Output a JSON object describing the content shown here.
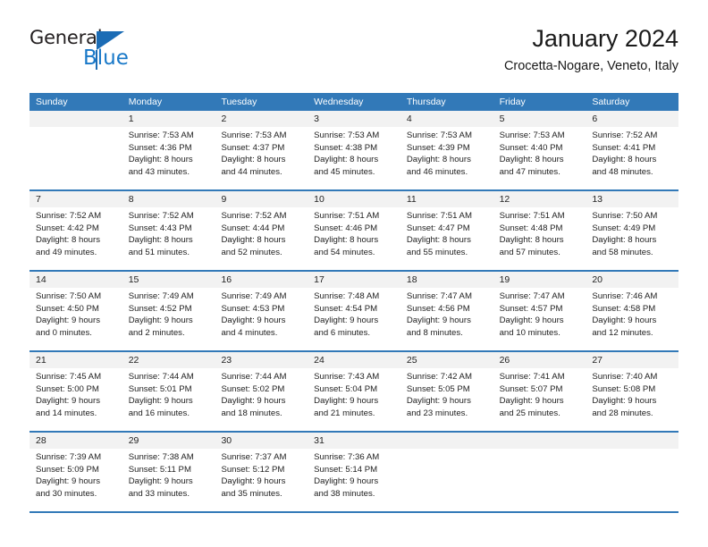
{
  "brand": {
    "name_primary": "General",
    "name_secondary": "Blue",
    "triangle_icon": "triangle-icon",
    "accent_color": "#1878c8"
  },
  "header": {
    "title": "January 2024",
    "subtitle": "Crocetta-Nogare, Veneto, Italy"
  },
  "calendar": {
    "header_bg": "#3279b8",
    "weekday_labels": [
      "Sunday",
      "Monday",
      "Tuesday",
      "Wednesday",
      "Thursday",
      "Friday",
      "Saturday"
    ],
    "weeks": [
      [
        {
          "day": "",
          "lines": []
        },
        {
          "day": "1",
          "lines": [
            "Sunrise: 7:53 AM",
            "Sunset: 4:36 PM",
            "Daylight: 8 hours",
            "and 43 minutes."
          ]
        },
        {
          "day": "2",
          "lines": [
            "Sunrise: 7:53 AM",
            "Sunset: 4:37 PM",
            "Daylight: 8 hours",
            "and 44 minutes."
          ]
        },
        {
          "day": "3",
          "lines": [
            "Sunrise: 7:53 AM",
            "Sunset: 4:38 PM",
            "Daylight: 8 hours",
            "and 45 minutes."
          ]
        },
        {
          "day": "4",
          "lines": [
            "Sunrise: 7:53 AM",
            "Sunset: 4:39 PM",
            "Daylight: 8 hours",
            "and 46 minutes."
          ]
        },
        {
          "day": "5",
          "lines": [
            "Sunrise: 7:53 AM",
            "Sunset: 4:40 PM",
            "Daylight: 8 hours",
            "and 47 minutes."
          ]
        },
        {
          "day": "6",
          "lines": [
            "Sunrise: 7:52 AM",
            "Sunset: 4:41 PM",
            "Daylight: 8 hours",
            "and 48 minutes."
          ]
        }
      ],
      [
        {
          "day": "7",
          "lines": [
            "Sunrise: 7:52 AM",
            "Sunset: 4:42 PM",
            "Daylight: 8 hours",
            "and 49 minutes."
          ]
        },
        {
          "day": "8",
          "lines": [
            "Sunrise: 7:52 AM",
            "Sunset: 4:43 PM",
            "Daylight: 8 hours",
            "and 51 minutes."
          ]
        },
        {
          "day": "9",
          "lines": [
            "Sunrise: 7:52 AM",
            "Sunset: 4:44 PM",
            "Daylight: 8 hours",
            "and 52 minutes."
          ]
        },
        {
          "day": "10",
          "lines": [
            "Sunrise: 7:51 AM",
            "Sunset: 4:46 PM",
            "Daylight: 8 hours",
            "and 54 minutes."
          ]
        },
        {
          "day": "11",
          "lines": [
            "Sunrise: 7:51 AM",
            "Sunset: 4:47 PM",
            "Daylight: 8 hours",
            "and 55 minutes."
          ]
        },
        {
          "day": "12",
          "lines": [
            "Sunrise: 7:51 AM",
            "Sunset: 4:48 PM",
            "Daylight: 8 hours",
            "and 57 minutes."
          ]
        },
        {
          "day": "13",
          "lines": [
            "Sunrise: 7:50 AM",
            "Sunset: 4:49 PM",
            "Daylight: 8 hours",
            "and 58 minutes."
          ]
        }
      ],
      [
        {
          "day": "14",
          "lines": [
            "Sunrise: 7:50 AM",
            "Sunset: 4:50 PM",
            "Daylight: 9 hours",
            "and 0 minutes."
          ]
        },
        {
          "day": "15",
          "lines": [
            "Sunrise: 7:49 AM",
            "Sunset: 4:52 PM",
            "Daylight: 9 hours",
            "and 2 minutes."
          ]
        },
        {
          "day": "16",
          "lines": [
            "Sunrise: 7:49 AM",
            "Sunset: 4:53 PM",
            "Daylight: 9 hours",
            "and 4 minutes."
          ]
        },
        {
          "day": "17",
          "lines": [
            "Sunrise: 7:48 AM",
            "Sunset: 4:54 PM",
            "Daylight: 9 hours",
            "and 6 minutes."
          ]
        },
        {
          "day": "18",
          "lines": [
            "Sunrise: 7:47 AM",
            "Sunset: 4:56 PM",
            "Daylight: 9 hours",
            "and 8 minutes."
          ]
        },
        {
          "day": "19",
          "lines": [
            "Sunrise: 7:47 AM",
            "Sunset: 4:57 PM",
            "Daylight: 9 hours",
            "and 10 minutes."
          ]
        },
        {
          "day": "20",
          "lines": [
            "Sunrise: 7:46 AM",
            "Sunset: 4:58 PM",
            "Daylight: 9 hours",
            "and 12 minutes."
          ]
        }
      ],
      [
        {
          "day": "21",
          "lines": [
            "Sunrise: 7:45 AM",
            "Sunset: 5:00 PM",
            "Daylight: 9 hours",
            "and 14 minutes."
          ]
        },
        {
          "day": "22",
          "lines": [
            "Sunrise: 7:44 AM",
            "Sunset: 5:01 PM",
            "Daylight: 9 hours",
            "and 16 minutes."
          ]
        },
        {
          "day": "23",
          "lines": [
            "Sunrise: 7:44 AM",
            "Sunset: 5:02 PM",
            "Daylight: 9 hours",
            "and 18 minutes."
          ]
        },
        {
          "day": "24",
          "lines": [
            "Sunrise: 7:43 AM",
            "Sunset: 5:04 PM",
            "Daylight: 9 hours",
            "and 21 minutes."
          ]
        },
        {
          "day": "25",
          "lines": [
            "Sunrise: 7:42 AM",
            "Sunset: 5:05 PM",
            "Daylight: 9 hours",
            "and 23 minutes."
          ]
        },
        {
          "day": "26",
          "lines": [
            "Sunrise: 7:41 AM",
            "Sunset: 5:07 PM",
            "Daylight: 9 hours",
            "and 25 minutes."
          ]
        },
        {
          "day": "27",
          "lines": [
            "Sunrise: 7:40 AM",
            "Sunset: 5:08 PM",
            "Daylight: 9 hours",
            "and 28 minutes."
          ]
        }
      ],
      [
        {
          "day": "28",
          "lines": [
            "Sunrise: 7:39 AM",
            "Sunset: 5:09 PM",
            "Daylight: 9 hours",
            "and 30 minutes."
          ]
        },
        {
          "day": "29",
          "lines": [
            "Sunrise: 7:38 AM",
            "Sunset: 5:11 PM",
            "Daylight: 9 hours",
            "and 33 minutes."
          ]
        },
        {
          "day": "30",
          "lines": [
            "Sunrise: 7:37 AM",
            "Sunset: 5:12 PM",
            "Daylight: 9 hours",
            "and 35 minutes."
          ]
        },
        {
          "day": "31",
          "lines": [
            "Sunrise: 7:36 AM",
            "Sunset: 5:14 PM",
            "Daylight: 9 hours",
            "and 38 minutes."
          ]
        },
        {
          "day": "",
          "lines": []
        },
        {
          "day": "",
          "lines": []
        },
        {
          "day": "",
          "lines": []
        }
      ]
    ]
  }
}
